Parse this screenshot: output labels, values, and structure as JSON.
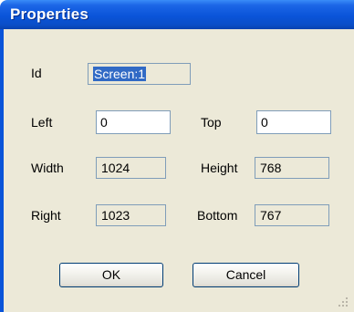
{
  "window": {
    "title": "Properties"
  },
  "fields": {
    "id": {
      "label": "Id",
      "value": "Screen:1"
    },
    "left": {
      "label": "Left",
      "value": "0"
    },
    "top": {
      "label": "Top",
      "value": "0"
    },
    "width": {
      "label": "Width",
      "value": "1024"
    },
    "height": {
      "label": "Height",
      "value": "768"
    },
    "right": {
      "label": "Right",
      "value": "1023"
    },
    "bottom": {
      "label": "Bottom",
      "value": "767"
    }
  },
  "buttons": {
    "ok": "OK",
    "cancel": "Cancel"
  },
  "colors": {
    "titlebar": "#0a54d9",
    "dialog_background": "#ece9d8",
    "field_border": "#7f9db9",
    "selection": "#316ac5"
  }
}
